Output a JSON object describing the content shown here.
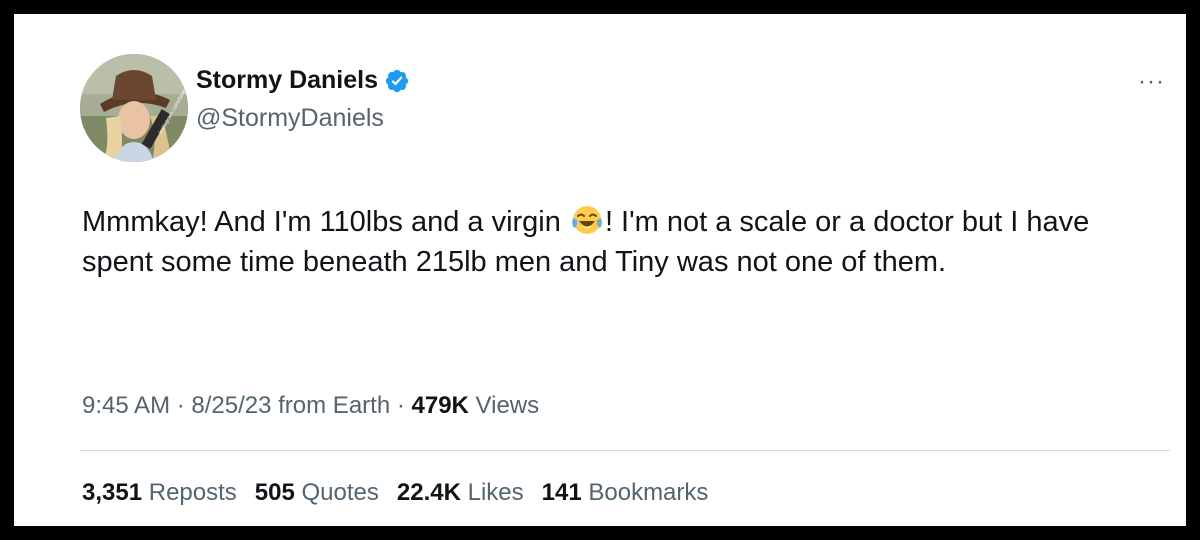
{
  "author": {
    "display_name": "Stormy Daniels",
    "handle": "@StormyDaniels",
    "avatar_overlay_text": "instagram.com/StormyDaniels"
  },
  "tweet": {
    "text_part1": "Mmmkay! And I'm 110lbs and a virgin ",
    "emoji": "face-with-tears-of-joy",
    "text_part2": "! I'm not a scale or a doctor but I have spent some time beneath 215lb men and Tiny was not one of them."
  },
  "meta": {
    "time": "9:45 AM",
    "sep1": " · ",
    "date": "8/25/23",
    "source": " from Earth",
    "sep2": " · ",
    "views_count": "479K",
    "views_label": " Views"
  },
  "stats": {
    "reposts_count": "3,351",
    "reposts_label": "Reposts",
    "quotes_count": "505",
    "quotes_label": "Quotes",
    "likes_count": "22.4K",
    "likes_label": "Likes",
    "bookmarks_count": "141",
    "bookmarks_label": "Bookmarks"
  },
  "more_menu": "···",
  "colors": {
    "verified_blue": "#1d9bf0",
    "text_primary": "#0f1419",
    "text_secondary": "#536471",
    "divider": "#cfd9de"
  }
}
